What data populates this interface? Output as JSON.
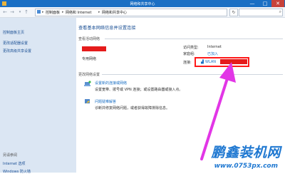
{
  "window": {
    "title": "网络和共享中心",
    "min": "—",
    "max": "□",
    "close": "✕"
  },
  "address": {
    "back": "←",
    "forward": "→",
    "up": "↑",
    "crumbs": [
      "控制面板",
      "网络和 Internet",
      "网络和共享中心"
    ],
    "separator": "▸",
    "refresh": "↻",
    "search_icon": "⌕"
  },
  "sidebar": {
    "items": [
      {
        "label": "控制面板主页"
      },
      {
        "label": "更改适配器设置"
      },
      {
        "label": "更改高级共享设置"
      }
    ],
    "see_also_title": "另请参阅",
    "see_also": [
      {
        "label": "Internet 选项"
      },
      {
        "label": "Windows 防火墙"
      }
    ]
  },
  "main": {
    "title": "查看基本网络信息并设置连接",
    "active_networks": "查看活动网络",
    "network_type": "专用网络",
    "access_type_label": "访问类型:",
    "access_type_value": "Internet",
    "homegroup_label": "家庭组:",
    "homegroup_value": "已加入",
    "connections_label": "连接:",
    "connection_name": "WLAN",
    "change_settings": "更改网络设置",
    "setup_title": "设置新的连接或网络",
    "setup_desc": "设置宽带、拨号或 VPN 连接；或设置路由器或接入点。",
    "troubleshoot_title": "问题疑难解答",
    "troubleshoot_desc": "诊断并修复网络问题，或者获得故障排除信息。"
  },
  "watermark": {
    "brand": "鹏鑫装机网",
    "url": "www.0753px.com"
  }
}
